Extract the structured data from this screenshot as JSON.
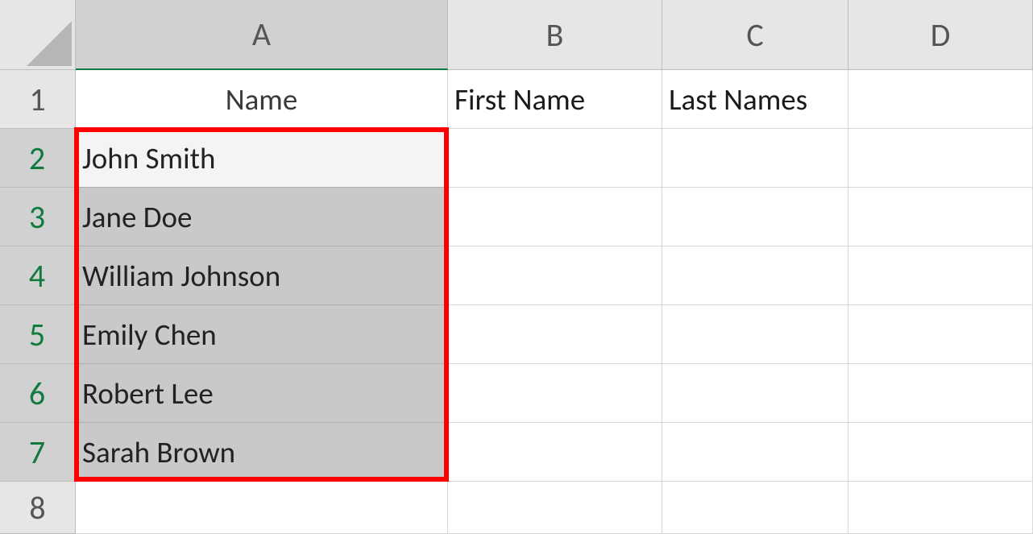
{
  "columns": {
    "A": "A",
    "B": "B",
    "C": "C",
    "D": "D"
  },
  "rows": {
    "r1": "1",
    "r2": "2",
    "r3": "3",
    "r4": "4",
    "r5": "5",
    "r6": "6",
    "r7": "7",
    "r8": "8"
  },
  "headers": {
    "A": "Name",
    "B": "First Name",
    "C": "Last Names"
  },
  "data": {
    "A2": "John Smith",
    "A3": "Jane Doe",
    "A4": "William Johnson",
    "A5": "Emily Chen",
    "A6": "Robert Lee",
    "A7": "Sarah Brown"
  },
  "selection": {
    "range": "A2:A7",
    "active_cell": "A2"
  }
}
